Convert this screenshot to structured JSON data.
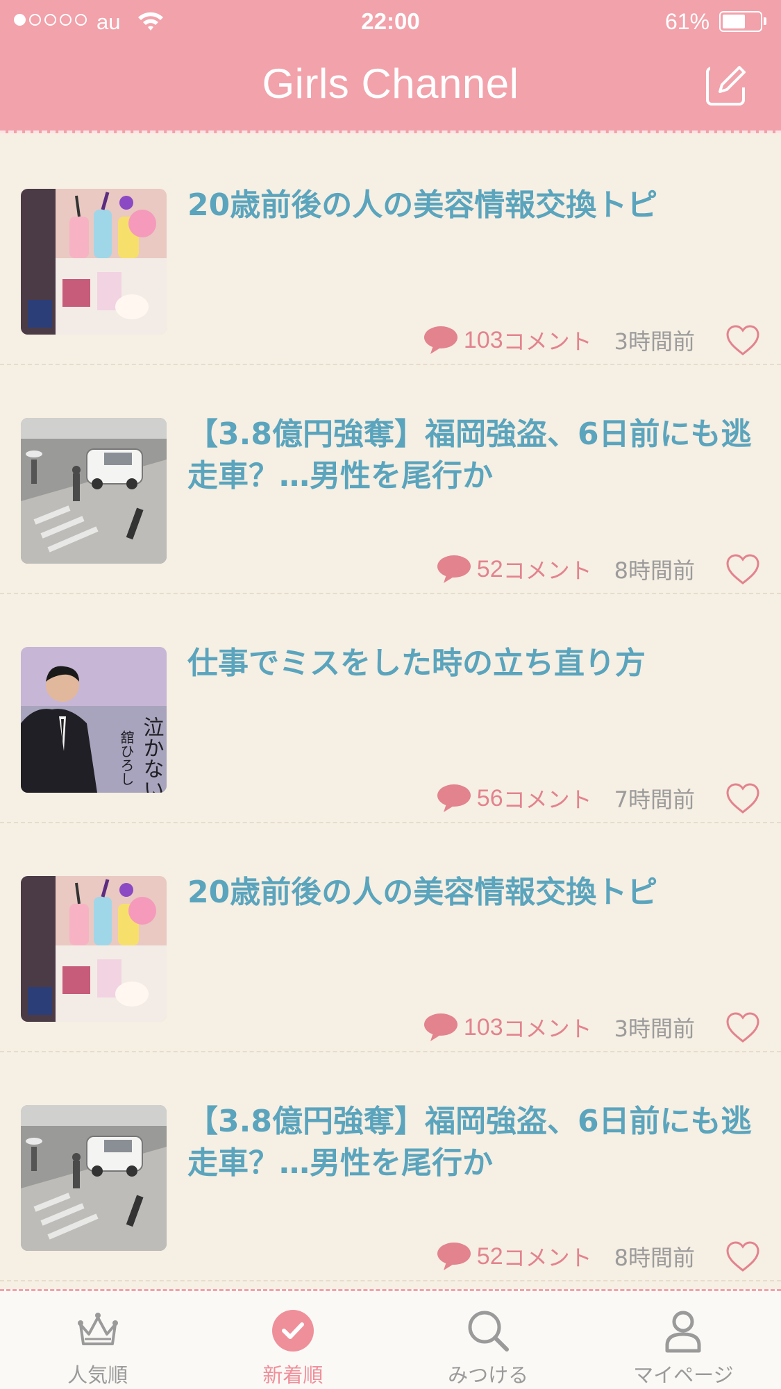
{
  "status_bar": {
    "carrier": "au",
    "time": "22:00",
    "battery_percent": "61%",
    "battery_level": 0.61,
    "signal_bars_filled": 1,
    "signal_bars_total": 5
  },
  "nav": {
    "title": "Girls Channel",
    "compose_icon": "compose-icon"
  },
  "colors": {
    "brand_pink": "#f2a2aa",
    "title_blue": "#5aa4bd",
    "comment_pink": "#e2838e",
    "background": "#f6efe3"
  },
  "topics": [
    {
      "title": "20歳前後の人の美容情報交換トピ",
      "comments": "103",
      "comment_label": "コメント",
      "time": "3時間前",
      "thumb": "cosmetics"
    },
    {
      "title": "【3.8億円強奪】福岡強盗、6日前にも逃走車？…男性を尾行か",
      "comments": "52",
      "comment_label": "コメント",
      "time": "8時間前",
      "thumb": "street"
    },
    {
      "title": "仕事でミスをした時の立ち直り方",
      "comments": "56",
      "comment_label": "コメント",
      "time": "7時間前",
      "thumb": "record"
    },
    {
      "title": "20歳前後の人の美容情報交換トピ",
      "comments": "103",
      "comment_label": "コメント",
      "time": "3時間前",
      "thumb": "cosmetics"
    },
    {
      "title": "【3.8億円強奪】福岡強盗、6日前にも逃走車？…男性を尾行か",
      "comments": "52",
      "comment_label": "コメント",
      "time": "8時間前",
      "thumb": "street"
    }
  ],
  "thumb_texts": {
    "record_title": "泣かないで",
    "record_artist": "舘ひろし"
  },
  "tabs": [
    {
      "label": "人気順",
      "icon": "crown-icon",
      "active": false
    },
    {
      "label": "新着順",
      "icon": "check-circle-icon",
      "active": true
    },
    {
      "label": "みつける",
      "icon": "search-icon",
      "active": false
    },
    {
      "label": "マイページ",
      "icon": "person-icon",
      "active": false
    }
  ]
}
